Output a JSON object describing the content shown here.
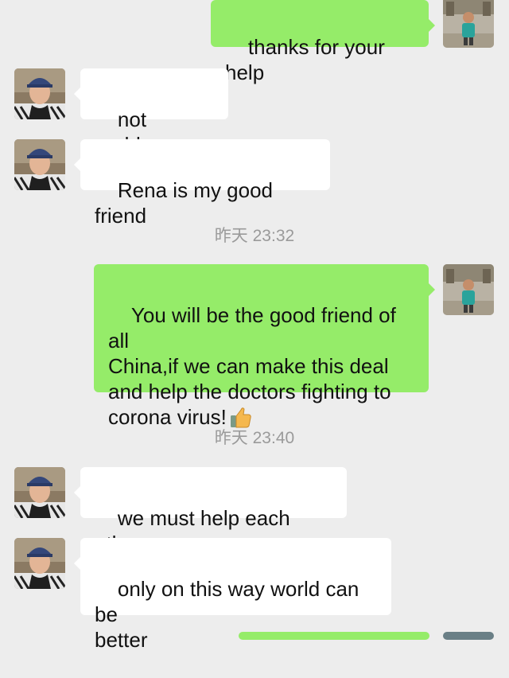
{
  "colors": {
    "background": "#ededed",
    "incoming_bubble": "#ffffff",
    "outgoing_bubble": "#95ec69",
    "timestamp_text": "#9a9a9a"
  },
  "messages": [
    {
      "direction": "outgoing",
      "text": "thanks for your help"
    },
    {
      "direction": "incoming",
      "text": "not problem"
    },
    {
      "direction": "incoming",
      "text": "Rena is my good friend"
    },
    {
      "direction": "outgoing",
      "text": "You will be the good friend of all\nChina,if we can make this deal\nand help the doctors fighting to\ncorona virus!",
      "emoji": "thumbs-up"
    },
    {
      "direction": "incoming",
      "text": "we must help each other"
    },
    {
      "direction": "incoming",
      "text": "only on this way world can be\nbetter"
    }
  ],
  "timestamps": [
    "昨天 23:32",
    "昨天 23:40"
  ]
}
